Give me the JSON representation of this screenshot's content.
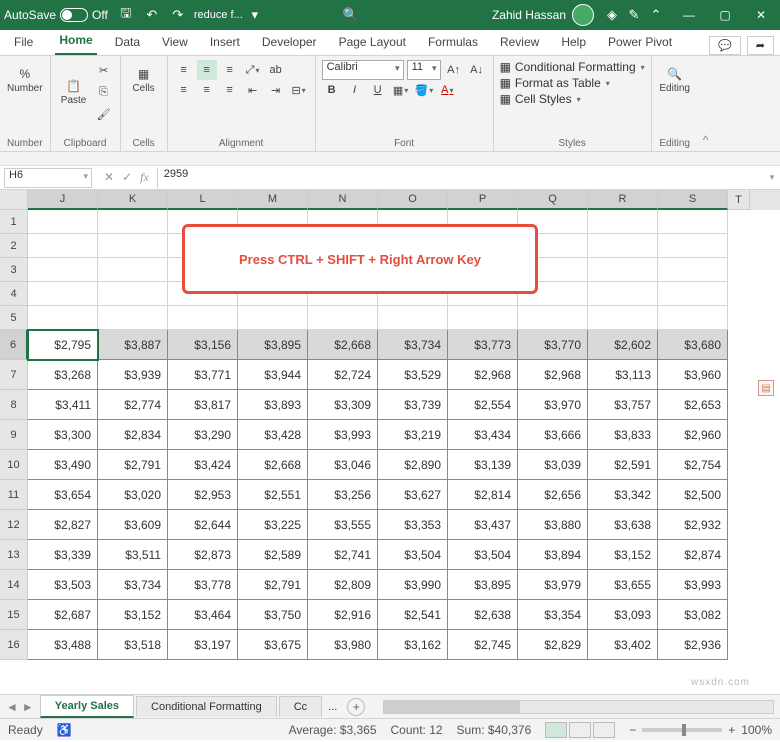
{
  "title": {
    "autosave": "AutoSave",
    "autosave_state": "Off",
    "filename": "reduce f...",
    "username": "Zahid Hassan"
  },
  "menu": {
    "file": "File",
    "home": "Home",
    "data": "Data",
    "view": "View",
    "insert": "Insert",
    "developer": "Developer",
    "pagelayout": "Page Layout",
    "formulas": "Formulas",
    "review": "Review",
    "help": "Help",
    "powerpivot": "Power Pivot"
  },
  "ribbon": {
    "number": "Number",
    "clipboard": "Clipboard",
    "paste": "Paste",
    "cells": "Cells",
    "alignment": "Alignment",
    "font_group": "Font",
    "font_name": "Calibri",
    "font_size": "11",
    "bold": "B",
    "italic": "I",
    "underline": "U",
    "styles_group": "Styles",
    "cond_fmt": "Conditional Formatting",
    "fmt_table": "Format as Table",
    "cell_styles": "Cell Styles",
    "editing": "Editing"
  },
  "formula": {
    "cell_ref": "H6",
    "value": "2959"
  },
  "columns": [
    "J",
    "K",
    "L",
    "M",
    "N",
    "O",
    "P",
    "Q",
    "R",
    "S",
    "T"
  ],
  "row_headers": [
    "1",
    "2",
    "3",
    "4",
    "5",
    "6",
    "7",
    "8",
    "9",
    "10",
    "11",
    "12",
    "13",
    "14",
    "15",
    "16"
  ],
  "callout": "Press CTRL + SHIFT + Right Arrow Key",
  "chart_data": {
    "type": "table",
    "columns": [
      "J",
      "K",
      "L",
      "M",
      "N",
      "O",
      "P",
      "Q",
      "R",
      "S"
    ],
    "rows": [
      [
        "$2,795",
        "$3,887",
        "$3,156",
        "$3,895",
        "$2,668",
        "$3,734",
        "$3,773",
        "$3,770",
        "$2,602",
        "$3,680"
      ],
      [
        "$3,268",
        "$3,939",
        "$3,771",
        "$3,944",
        "$2,724",
        "$3,529",
        "$2,968",
        "$2,968",
        "$3,113",
        "$3,960"
      ],
      [
        "$3,411",
        "$2,774",
        "$3,817",
        "$3,893",
        "$3,309",
        "$3,739",
        "$2,554",
        "$3,970",
        "$3,757",
        "$2,653"
      ],
      [
        "$3,300",
        "$2,834",
        "$3,290",
        "$3,428",
        "$3,993",
        "$3,219",
        "$3,434",
        "$3,666",
        "$3,833",
        "$2,960"
      ],
      [
        "$3,490",
        "$2,791",
        "$3,424",
        "$2,668",
        "$3,046",
        "$2,890",
        "$3,139",
        "$3,039",
        "$2,591",
        "$2,754"
      ],
      [
        "$3,654",
        "$3,020",
        "$2,953",
        "$2,551",
        "$3,256",
        "$3,627",
        "$2,814",
        "$2,656",
        "$3,342",
        "$2,500"
      ],
      [
        "$2,827",
        "$3,609",
        "$2,644",
        "$3,225",
        "$3,555",
        "$3,353",
        "$3,437",
        "$3,880",
        "$3,638",
        "$2,932"
      ],
      [
        "$3,339",
        "$3,511",
        "$2,873",
        "$2,589",
        "$2,741",
        "$3,504",
        "$3,504",
        "$3,894",
        "$3,152",
        "$2,874"
      ],
      [
        "$3,503",
        "$3,734",
        "$3,778",
        "$2,791",
        "$2,809",
        "$3,990",
        "$3,895",
        "$3,979",
        "$3,655",
        "$3,993"
      ],
      [
        "$2,687",
        "$3,152",
        "$3,464",
        "$3,750",
        "$2,916",
        "$2,541",
        "$2,638",
        "$3,354",
        "$3,093",
        "$3,082"
      ],
      [
        "$3,488",
        "$3,518",
        "$3,197",
        "$3,675",
        "$3,980",
        "$3,162",
        "$2,745",
        "$2,829",
        "$3,402",
        "$2,936"
      ]
    ]
  },
  "tabs": {
    "yearly": "Yearly Sales",
    "cond": "Conditional Formatting",
    "cc": "Cc",
    "more": "..."
  },
  "status": {
    "ready": "Ready",
    "avg": "Average: $3,365",
    "count": "Count: 12",
    "sum": "Sum: $40,376",
    "zoom": "100%"
  },
  "watermark": "wsxdn.com"
}
